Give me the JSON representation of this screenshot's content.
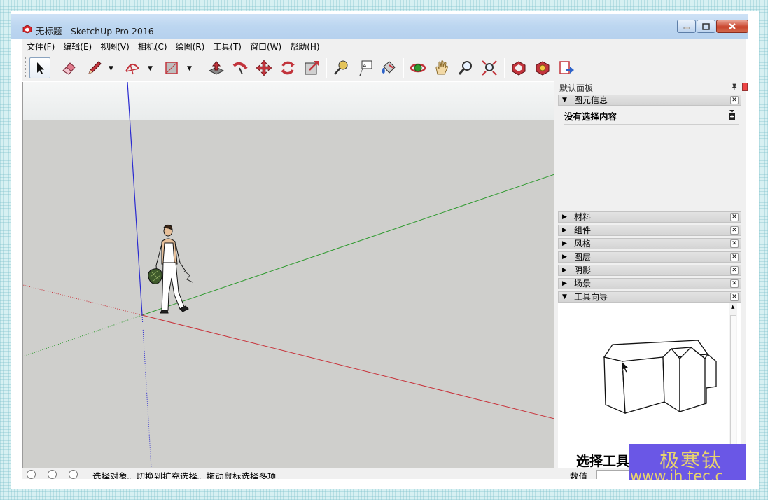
{
  "window": {
    "title": "无标题 - SketchUp Pro 2016"
  },
  "menu": [
    "文件(F)",
    "编辑(E)",
    "视图(V)",
    "相机(C)",
    "绘图(R)",
    "工具(T)",
    "窗口(W)",
    "帮助(H)"
  ],
  "toolbar": {
    "tools": [
      "select-tool",
      "eraser-tool",
      "line-tool",
      "arc-tool",
      "rectangle-tool",
      "push-pull-tool",
      "follow-me-tool",
      "move-tool",
      "rotate-tool",
      "scale-tool",
      "tape-measure-tool",
      "text-tool",
      "paint-bucket-tool",
      "orbit-tool",
      "pan-tool",
      "zoom-tool",
      "zoom-extents-tool",
      "3d-warehouse-tool",
      "extension-warehouse-tool",
      "send-to-layout-tool"
    ],
    "text_tool_glyph": "A1"
  },
  "tray": {
    "title": "默认面板",
    "entity_info": {
      "header": "图元信息",
      "empty_text": "没有选择内容"
    },
    "panels": [
      "材料",
      "组件",
      "风格",
      "图层",
      "阴影",
      "场景"
    ],
    "instructor": {
      "header": "工具向导",
      "title": "选择工具"
    }
  },
  "status": {
    "text": "选择对象。切换到扩充选择。拖动鼠标选择多项。",
    "value_label": "数值"
  },
  "watermark": {
    "line1": "极寒钛",
    "line2": "www.jh.tec.c"
  },
  "colors": {
    "viewport_ground": "#cfcfcc",
    "axis_red": "#c8323a",
    "axis_green": "#2e9a2e",
    "axis_blue": "#2a2ad0",
    "watermark_bg": "#6a57e6",
    "watermark_text": "#e8d36e"
  }
}
